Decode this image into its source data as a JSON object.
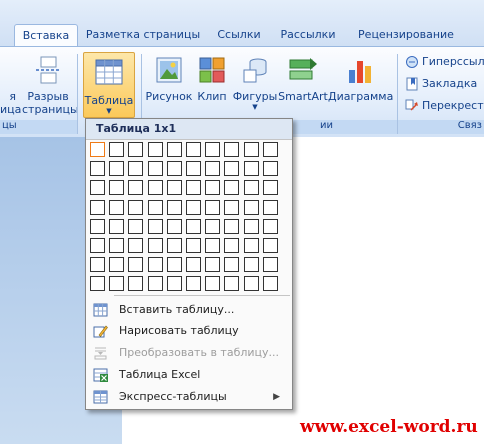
{
  "tabs": [
    {
      "label": "Вставка",
      "active": true
    },
    {
      "label": "Разметка страницы",
      "active": false
    },
    {
      "label": "Ссылки",
      "active": false
    },
    {
      "label": "Рассылки",
      "active": false
    },
    {
      "label": "Рецензирование",
      "active": false
    }
  ],
  "ribbon": {
    "left_partial": {
      "line1": "я",
      "line2": "ица"
    },
    "page_break": {
      "line1": "Разрыв",
      "line2": "страницы"
    },
    "left_group_label": "цы",
    "table_button": {
      "label": "Таблица"
    },
    "illustrations": [
      {
        "label": "Рисунок",
        "icon": "picture-icon"
      },
      {
        "label": "Клип",
        "icon": "clipart-icon"
      },
      {
        "label": "Фигуры",
        "icon": "shapes-icon"
      },
      {
        "label": "SmartArt",
        "icon": "smartart-icon"
      },
      {
        "label": "Диаграмма",
        "icon": "chart-icon"
      }
    ],
    "illustrations_group_label": "ии",
    "links": [
      {
        "label": "Гиперссылк",
        "icon": "hyperlink-icon"
      },
      {
        "label": "Закладка",
        "icon": "bookmark-icon"
      },
      {
        "label": "Перекрест",
        "icon": "cross-reference-icon"
      }
    ],
    "links_group_label": "Связ"
  },
  "table_menu": {
    "header": "Таблица 1x1",
    "grid": {
      "columns": 10,
      "rows": 8,
      "selected_columns": 1,
      "selected_rows": 1
    },
    "items": [
      {
        "label": "Вставить таблицу...",
        "icon": "insert-table-icon",
        "disabled": false,
        "submenu": false
      },
      {
        "label": "Нарисовать таблицу",
        "icon": "draw-table-icon",
        "disabled": false,
        "submenu": false
      },
      {
        "label": "Преобразовать в таблицу...",
        "icon": "convert-to-table-icon",
        "disabled": true,
        "submenu": false
      },
      {
        "label": "Таблица Excel",
        "icon": "excel-table-icon",
        "disabled": false,
        "submenu": false
      },
      {
        "label": "Экспресс-таблицы",
        "icon": "quick-tables-icon",
        "disabled": false,
        "submenu": true
      }
    ],
    "submenu_arrow": "▶"
  },
  "watermark": "www.excel-word.ru"
}
